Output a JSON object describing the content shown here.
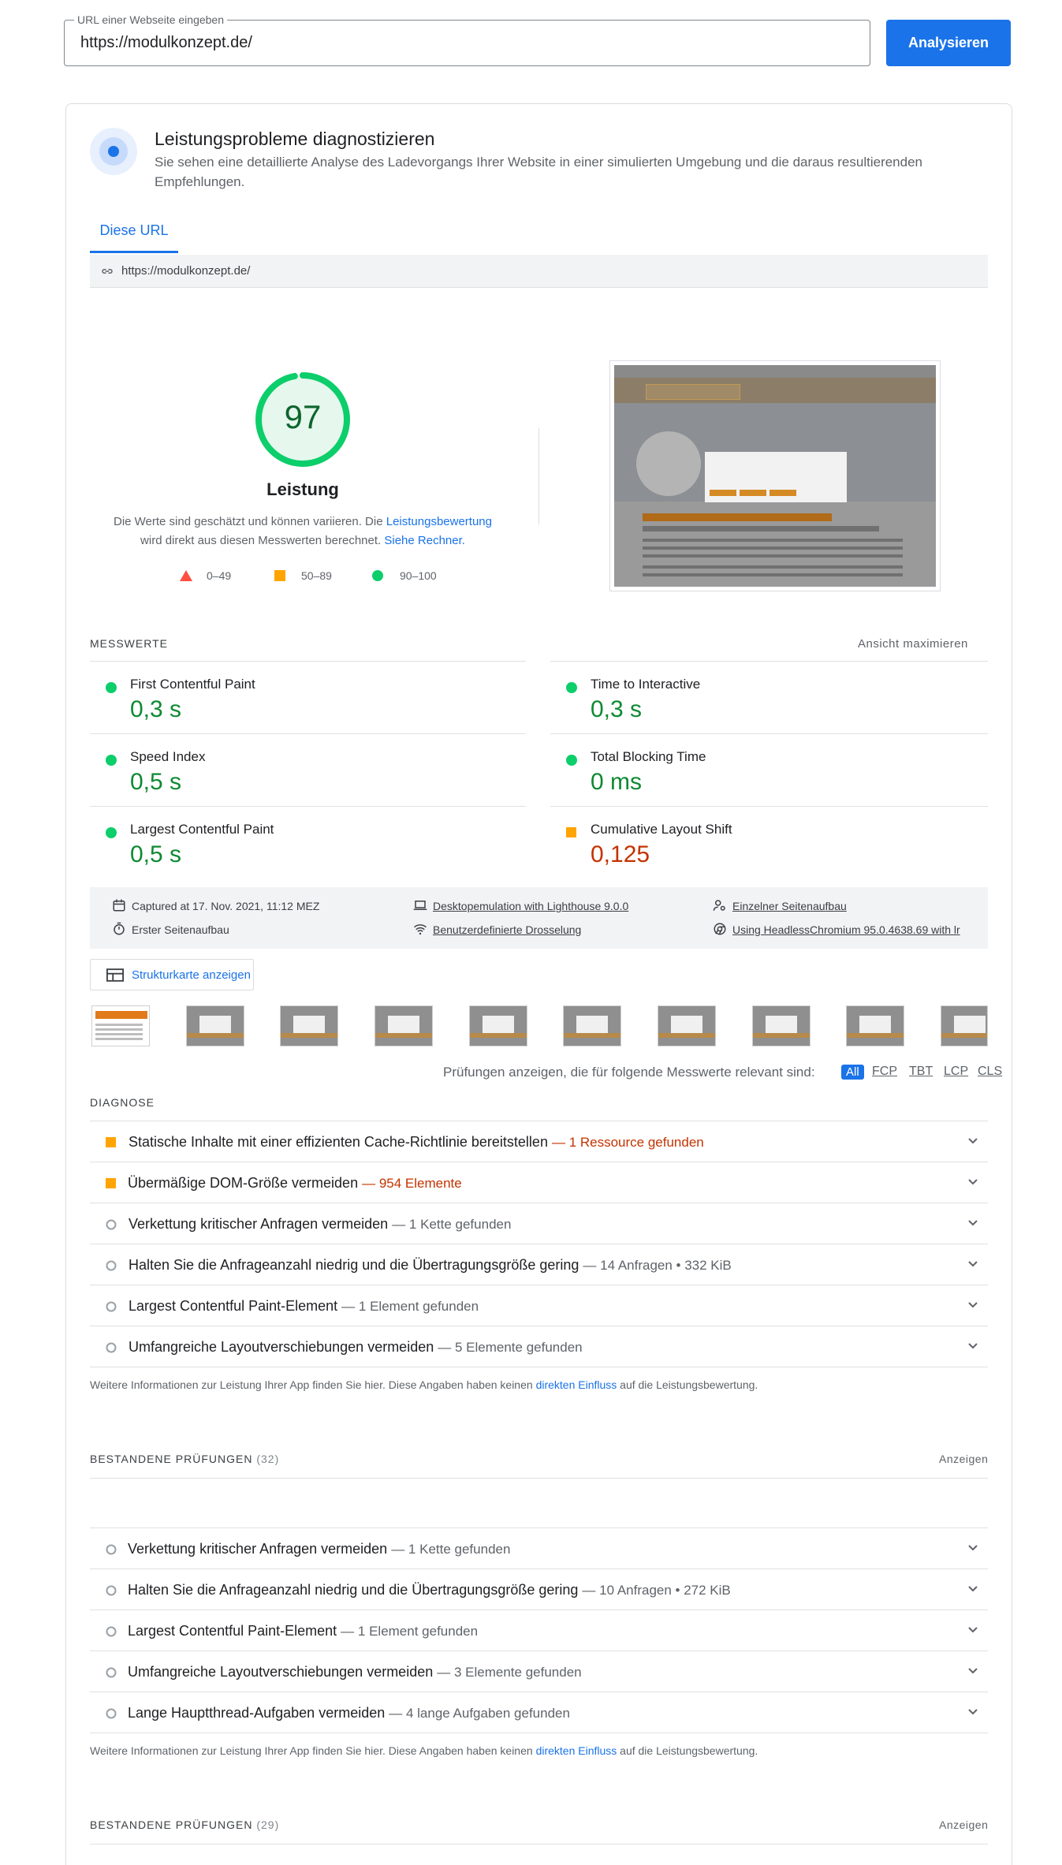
{
  "url_input": {
    "label": "URL einer Webseite eingeben",
    "value": "https://modulkonzept.de/"
  },
  "analyze_button": "Analysieren",
  "header": {
    "title": "Leistungsprobleme diagnostizieren",
    "description": "Sie sehen eine detaillierte Analyse des Ladevorgangs Ihrer Website in einer simulierten Umgebung und die daraus resultierenden Empfehlungen."
  },
  "tab": "Diese URL",
  "tested_url": "https://modulkonzept.de/",
  "score": {
    "value": 97,
    "label": "Leistung",
    "note_1": "Die Werte sind geschätzt und können variieren. Die ",
    "note_link_1": "Leistungsbewertung",
    "note_2": " wird direkt aus diesen Messwerten berechnet. ",
    "note_link_2": "Siehe Rechner.",
    "colors": {
      "pass": "#0cce6b",
      "average": "#ffa400",
      "fail": "#ff4e42"
    }
  },
  "legend": [
    {
      "icon": "triangle-icon",
      "range": "0–49"
    },
    {
      "icon": "square-icon",
      "range": "50–89"
    },
    {
      "icon": "circle-icon",
      "range": "90–100"
    }
  ],
  "metrics": {
    "title": "MESSWERTE",
    "expand": "Ansicht maximieren",
    "items": [
      {
        "name": "First Contentful Paint",
        "value": "0,3 s",
        "status": "pass"
      },
      {
        "name": "Time to Interactive",
        "value": "0,3 s",
        "status": "pass"
      },
      {
        "name": "Speed Index",
        "value": "0,5 s",
        "status": "pass"
      },
      {
        "name": "Total Blocking Time",
        "value": "0 ms",
        "status": "pass"
      },
      {
        "name": "Largest Contentful Paint",
        "value": "0,5 s",
        "status": "pass"
      },
      {
        "name": "Cumulative Layout Shift",
        "value": "0,125",
        "status": "average"
      }
    ]
  },
  "runtime": {
    "captured": "Captured at 17. Nov. 2021, 11:12 MEZ",
    "emulation": "Desktopemulation with Lighthouse 9.0.0",
    "single_load": "Einzelner Seitenaufbau",
    "initial_load": "Erster Seitenaufbau",
    "throttling": "Benutzerdefinierte Drosselung",
    "browser": "Using HeadlessChromium 95.0.4638.69 with lr"
  },
  "treemap_button": "Strukturkarte anzeigen",
  "filter": {
    "label": "Prüfungen anzeigen, die für folgende Messwerte relevant sind:",
    "chips": [
      "All",
      "FCP",
      "TBT",
      "LCP",
      "CLS"
    ]
  },
  "diagnostics": {
    "title": "DIAGNOSE",
    "items": [
      {
        "title": "Statische Inhalte mit einer effizienten Cache-Richtlinie bereitstellen",
        "detail": "— 1 Ressource gefunden",
        "status": "average"
      },
      {
        "title": "Übermäßige DOM-Größe vermeiden",
        "detail": "— 954 Elemente",
        "status": "average"
      },
      {
        "title": "Verkettung kritischer Anfragen vermeiden",
        "detail": "— 1 Kette gefunden",
        "status": "info"
      },
      {
        "title": "Halten Sie die Anfrageanzahl niedrig und die Übertragungsgröße gering",
        "detail": "— 14 Anfragen • 332 KiB",
        "status": "info"
      },
      {
        "title": "Largest Contentful Paint-Element",
        "detail": "— 1 Element gefunden",
        "status": "info"
      },
      {
        "title": "Umfangreiche Layoutverschiebungen vermeiden",
        "detail": "— 5 Elemente gefunden",
        "status": "info"
      }
    ],
    "footnote_1": "Weitere Informationen zur Leistung Ihrer App finden Sie hier. Diese Angaben haben keinen ",
    "footnote_link": "direkten Einfluss",
    "footnote_2": " auf die Leistungsbewertung."
  },
  "passed_1": {
    "title": "BESTANDENE PRÜFUNGEN",
    "count": "(32)",
    "show": "Anzeigen"
  },
  "diagnostics_2": {
    "items": [
      {
        "title": "Verkettung kritischer Anfragen vermeiden",
        "detail": "— 1 Kette gefunden"
      },
      {
        "title": "Halten Sie die Anfrageanzahl niedrig und die Übertragungsgröße gering",
        "detail": "— 10 Anfragen • 272 KiB"
      },
      {
        "title": "Largest Contentful Paint-Element",
        "detail": "— 1 Element gefunden"
      },
      {
        "title": "Umfangreiche Layoutverschiebungen vermeiden",
        "detail": "— 3 Elemente gefunden"
      },
      {
        "title": "Lange Hauptthread-Aufgaben vermeiden",
        "detail": "— 4 lange Aufgaben gefunden"
      }
    ]
  },
  "passed_2": {
    "title": "BESTANDENE PRÜFUNGEN",
    "count": "(29)",
    "show": "Anzeigen"
  }
}
